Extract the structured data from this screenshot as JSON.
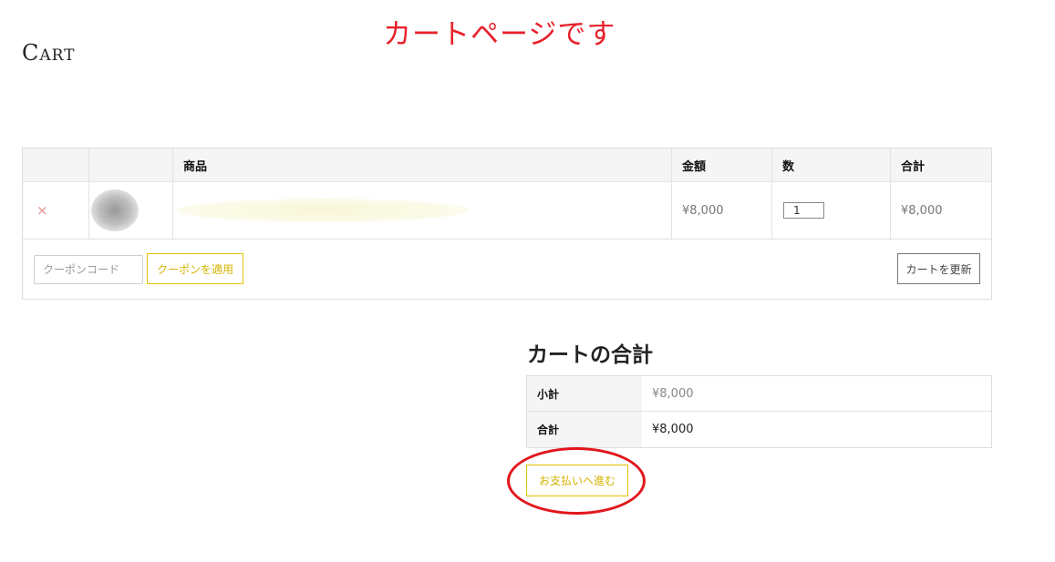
{
  "annotation": {
    "title": "カートページです"
  },
  "page": {
    "title": "Cart"
  },
  "cart_table": {
    "headers": {
      "product": "商品",
      "price": "金額",
      "quantity": "数",
      "total": "合計"
    },
    "items": [
      {
        "remove": "×",
        "price": "¥8,000",
        "quantity": "1",
        "total": "¥8,000"
      }
    ],
    "actions": {
      "coupon_placeholder": "クーポンコード",
      "apply_coupon_label": "クーポンを適用",
      "update_cart_label": "カートを更新"
    }
  },
  "cart_totals": {
    "title": "カートの合計",
    "subtotal_label": "小計",
    "subtotal_value": "¥8,000",
    "total_label": "合計",
    "total_value": "¥8,000",
    "checkout_label": "お支払いへ進む"
  },
  "colors": {
    "annotation_red": "#e8212b",
    "accent_yellow": "#e6c200",
    "remove_icon": "#e8908f"
  }
}
